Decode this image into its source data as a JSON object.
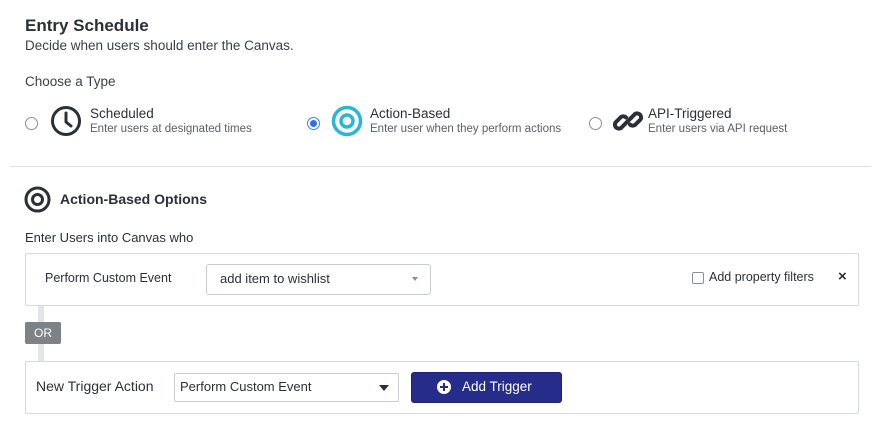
{
  "header": {
    "title": "Entry Schedule",
    "subtitle": "Decide when users should enter the Canvas."
  },
  "type_section": {
    "label": "Choose a Type",
    "options": [
      {
        "title": "Scheduled",
        "description": "Enter users at designated times",
        "icon": "clock-icon",
        "selected": false
      },
      {
        "title": "Action-Based",
        "description": "Enter user when they perform actions",
        "icon": "target-icon",
        "selected": true
      },
      {
        "title": "API-Triggered",
        "description": "Enter users via API request",
        "icon": "link-icon",
        "selected": false
      }
    ]
  },
  "options_section": {
    "title": "Action-Based Options",
    "enter_label": "Enter Users into Canvas who",
    "trigger": {
      "label": "Perform Custom Event",
      "event_value": "add item to wishlist",
      "property_filter_label": "Add property filters",
      "property_filter_checked": false,
      "remove_symbol": "×"
    },
    "or_label": "OR",
    "new_trigger": {
      "label": "New Trigger Action",
      "select_value": "Perform Custom Event",
      "button_label": "Add Trigger"
    }
  },
  "colors": {
    "accent_blue": "#2f6fe8",
    "action_icon_cyan": "#2bb6d8",
    "button_navy": "#262c8a",
    "or_badge_gray": "#7d8287"
  }
}
